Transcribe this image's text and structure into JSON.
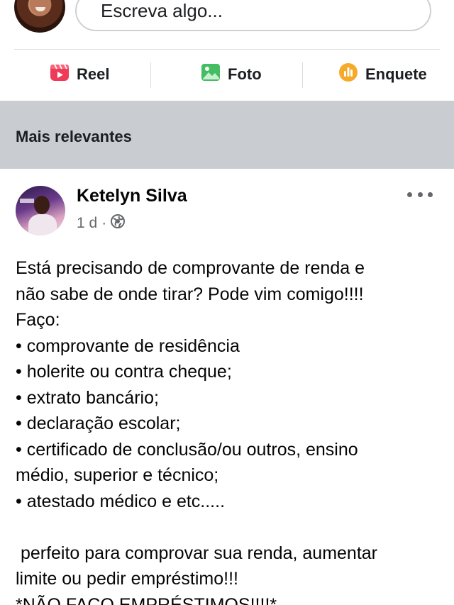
{
  "composer": {
    "placeholder": "Escreva algo..."
  },
  "actions": [
    {
      "label": "Reel",
      "icon": "reel-icon",
      "color": "#ee3b58"
    },
    {
      "label": "Foto",
      "icon": "photo-icon",
      "color": "#45bd62"
    },
    {
      "label": "Enquete",
      "icon": "poll-icon",
      "color": "#f7b928"
    }
  ],
  "feed": {
    "sort_label": "Mais relevantes"
  },
  "post": {
    "author": "Ketelyn Silva",
    "time": "1 d",
    "separator": "·",
    "privacy_icon": "globe-icon",
    "lines": [
      "Está precisando de comprovante de renda e",
      "não sabe de onde tirar? Pode vim comigo!!!!",
      "Faço:",
      "• comprovante de residência",
      "• holerite ou contra cheque;",
      "• extrato bancário;",
      "• declaração escolar;",
      "• certificado de conclusão/ou outros, ensino",
      "médio, superior e técnico;",
      "• atestado médico e etc.....",
      "",
      " perfeito para comprovar sua renda, aumentar",
      "limite ou pedir empréstimo!!!",
      "*NÃO FAÇO EMPRÉSTIMOS!!!!*"
    ]
  },
  "colors": {
    "band": "#c9ccd1",
    "secondary_text": "#65676b"
  }
}
